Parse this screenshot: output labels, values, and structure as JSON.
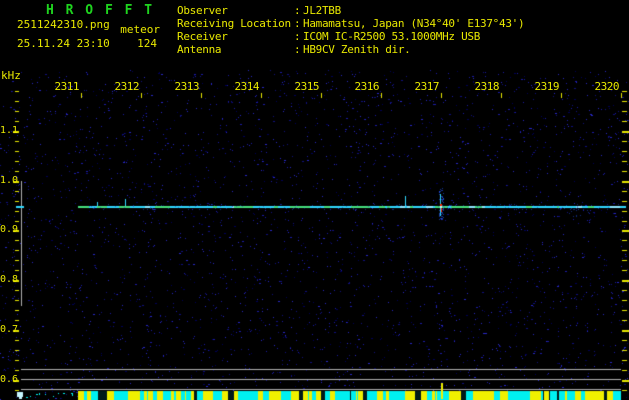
{
  "header": {
    "title": "H R O F F T",
    "filename": "2511242310.png",
    "mode": "meteor",
    "datetime": "25.11.24 23:10",
    "count": "124",
    "separator": ":",
    "info": [
      {
        "label": "Observer",
        "value": "JL2TBB"
      },
      {
        "label": "Receiving Location",
        "value": "Hamamatsu, Japan (N34°40' E137°43')"
      },
      {
        "label": "Receiver",
        "value": "ICOM IC-R2500 53.1000MHz USB"
      },
      {
        "label": "Antenna",
        "value": "HB9CV Zenith dir."
      }
    ]
  },
  "colors": {
    "label_yellow": "#e8e800",
    "title_green": "#1fd41f",
    "carrier_cyan": "#30d8ff",
    "carrier_green": "#46e07e",
    "bar_cyan": "#00f0f0",
    "bar_yellow": "#f0f000",
    "reference_gray": "#b0b0b0",
    "meteor_red": "#ff2a00",
    "noise_blues": [
      "#00005a",
      "#101080",
      "#1c1ca8",
      "#2828c8"
    ]
  },
  "chart_data": {
    "type": "heatmap",
    "title": "HROFFT 10-minute radio meteor spectrogram",
    "ylabel": "kHz",
    "y_major_ticks": [
      1.1,
      1.0,
      0.9,
      0.8,
      0.7,
      0.6
    ],
    "y_minor_step_khz": 0.02,
    "y_range_khz": [
      0.58,
      1.18
    ],
    "x_tick_labels": [
      "2311",
      "2312",
      "2313",
      "2314",
      "2315",
      "2316",
      "2317",
      "2318",
      "2319",
      "2320"
    ],
    "x_start_time": "23:10",
    "x_span_minutes": 10,
    "grid": "off",
    "carrier_line": {
      "freq_khz": 0.95,
      "start_minute": 0.95,
      "end_minute": 10.0
    },
    "count_band_khz": [
      0.75,
      1.0
    ],
    "level_reference_lines_khz": [
      0.62,
      0.6,
      0.58
    ],
    "meteor_echo": {
      "minute": 7.0,
      "freq_khz": 0.95
    },
    "minor_blips_minutes": [
      1.27,
      1.73,
      6.4
    ],
    "activity_bar": {
      "start_minute": 0.95,
      "end_minute": 10.0,
      "spike_minute": 7.0
    }
  }
}
